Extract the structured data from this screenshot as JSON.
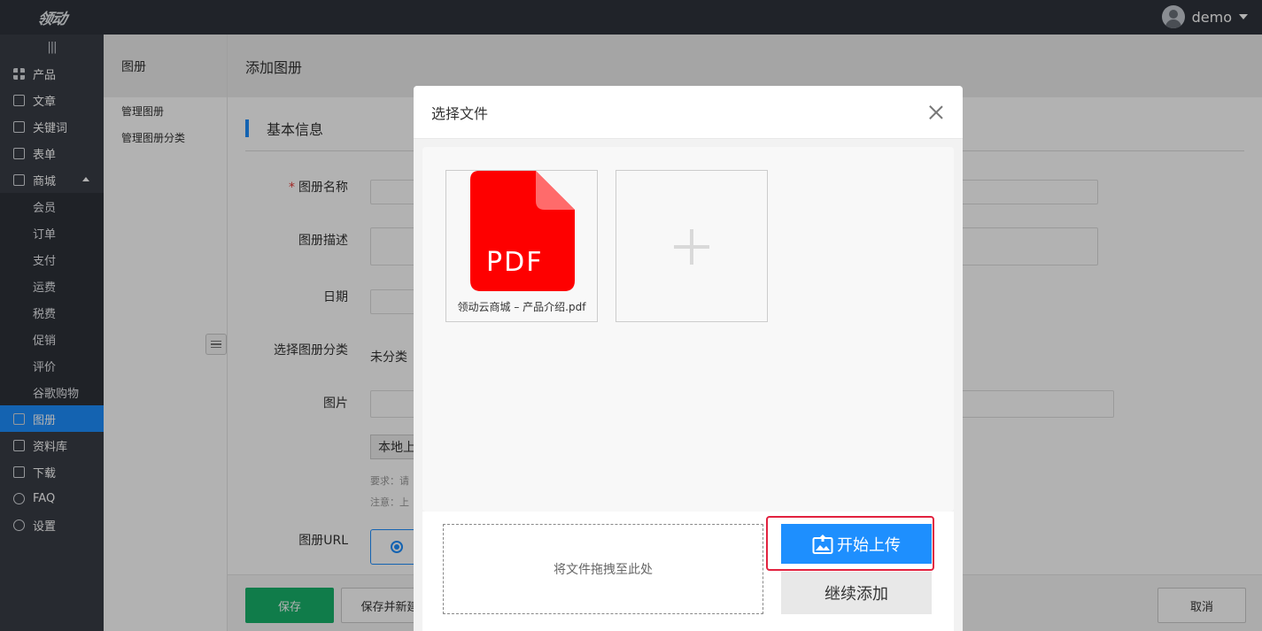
{
  "topbar": {
    "logo": "领动",
    "username": "demo"
  },
  "sidebar": {
    "collapse_glyph": "|||",
    "items": [
      {
        "label": "产品",
        "icon": "grid-icon"
      },
      {
        "label": "文章",
        "icon": "document-icon"
      },
      {
        "label": "关键词",
        "icon": "keyword-icon"
      },
      {
        "label": "表单",
        "icon": "clipboard-icon"
      },
      {
        "label": "商城",
        "icon": "shopping-bag-icon"
      }
    ],
    "mall_sub": [
      "会员",
      "订单",
      "支付",
      "运费",
      "税费",
      "促销",
      "评价",
      "谷歌购物"
    ],
    "items_after": [
      {
        "label": "图册",
        "icon": "album-icon",
        "active": true
      },
      {
        "label": "资料库",
        "icon": "database-icon"
      },
      {
        "label": "下载",
        "icon": "download-icon"
      },
      {
        "label": "FAQ",
        "icon": "chat-icon"
      },
      {
        "label": "设置",
        "icon": "gear-icon"
      }
    ]
  },
  "subnav": {
    "title": "图册",
    "items": [
      "管理图册",
      "管理图册分类"
    ]
  },
  "main": {
    "title": "添加图册",
    "section": "基本信息",
    "fields": {
      "name_label": "图册名称",
      "desc_label": "图册描述",
      "date_label": "日期",
      "category_label": "选择图册分类",
      "category_value": "未分类",
      "image_label": "图片",
      "local_upload": "本地上",
      "hint1": "要求：请",
      "hint2": "注意：上",
      "url_label": "图册URL"
    },
    "footer": {
      "save": "保存",
      "save_new": "保存并新建",
      "cancel": "取消"
    }
  },
  "modal": {
    "title": "选择文件",
    "file": {
      "type_label": "PDF",
      "name": "领动云商城 – 产品介绍.pdf"
    },
    "dropzone": "将文件拖拽至此处",
    "start_upload": "开始上传",
    "continue_add": "继续添加"
  },
  "colors": {
    "accent": "#1e8ffe",
    "save_green": "#17b26a",
    "pdf_red": "#fe0000",
    "highlight": "#e2223f"
  }
}
